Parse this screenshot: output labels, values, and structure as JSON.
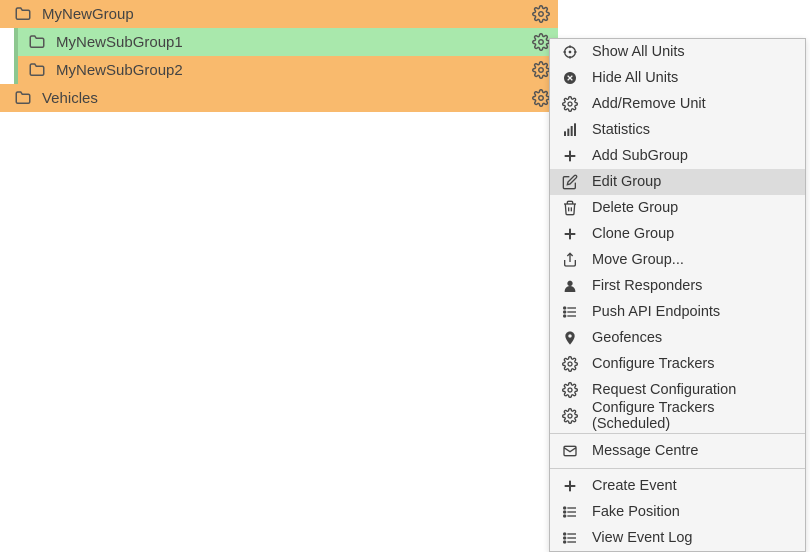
{
  "tree": {
    "items": [
      {
        "label": "MyNewGroup",
        "indent": 0,
        "color": "orange"
      },
      {
        "label": "MyNewSubGroup1",
        "indent": 1,
        "color": "green"
      },
      {
        "label": "MyNewSubGroup2",
        "indent": 1,
        "color": "orange"
      },
      {
        "label": "Vehicles",
        "indent": 0,
        "color": "orange"
      }
    ]
  },
  "menu": {
    "groups": [
      [
        {
          "icon": "crosshair",
          "label": "Show All Units"
        },
        {
          "icon": "x-circle",
          "label": "Hide All Units"
        },
        {
          "icon": "gear",
          "label": "Add/Remove Unit"
        },
        {
          "icon": "bars",
          "label": "Statistics"
        },
        {
          "icon": "plus",
          "label": "Add SubGroup"
        },
        {
          "icon": "edit",
          "label": "Edit Group",
          "highlight": true
        },
        {
          "icon": "trash",
          "label": "Delete Group"
        },
        {
          "icon": "plus",
          "label": "Clone Group"
        },
        {
          "icon": "share",
          "label": "Move Group..."
        },
        {
          "icon": "person",
          "label": "First Responders"
        },
        {
          "icon": "list",
          "label": "Push API Endpoints"
        },
        {
          "icon": "pin",
          "label": "Geofences"
        },
        {
          "icon": "gear",
          "label": "Configure Trackers"
        },
        {
          "icon": "gear",
          "label": "Request Configuration"
        },
        {
          "icon": "gear",
          "label": "Configure Trackers (Scheduled)"
        }
      ],
      [
        {
          "icon": "envelope",
          "label": "Message Centre"
        }
      ],
      [
        {
          "icon": "plus",
          "label": "Create Event"
        },
        {
          "icon": "list",
          "label": "Fake Position"
        },
        {
          "icon": "list",
          "label": "View Event Log"
        }
      ]
    ]
  }
}
